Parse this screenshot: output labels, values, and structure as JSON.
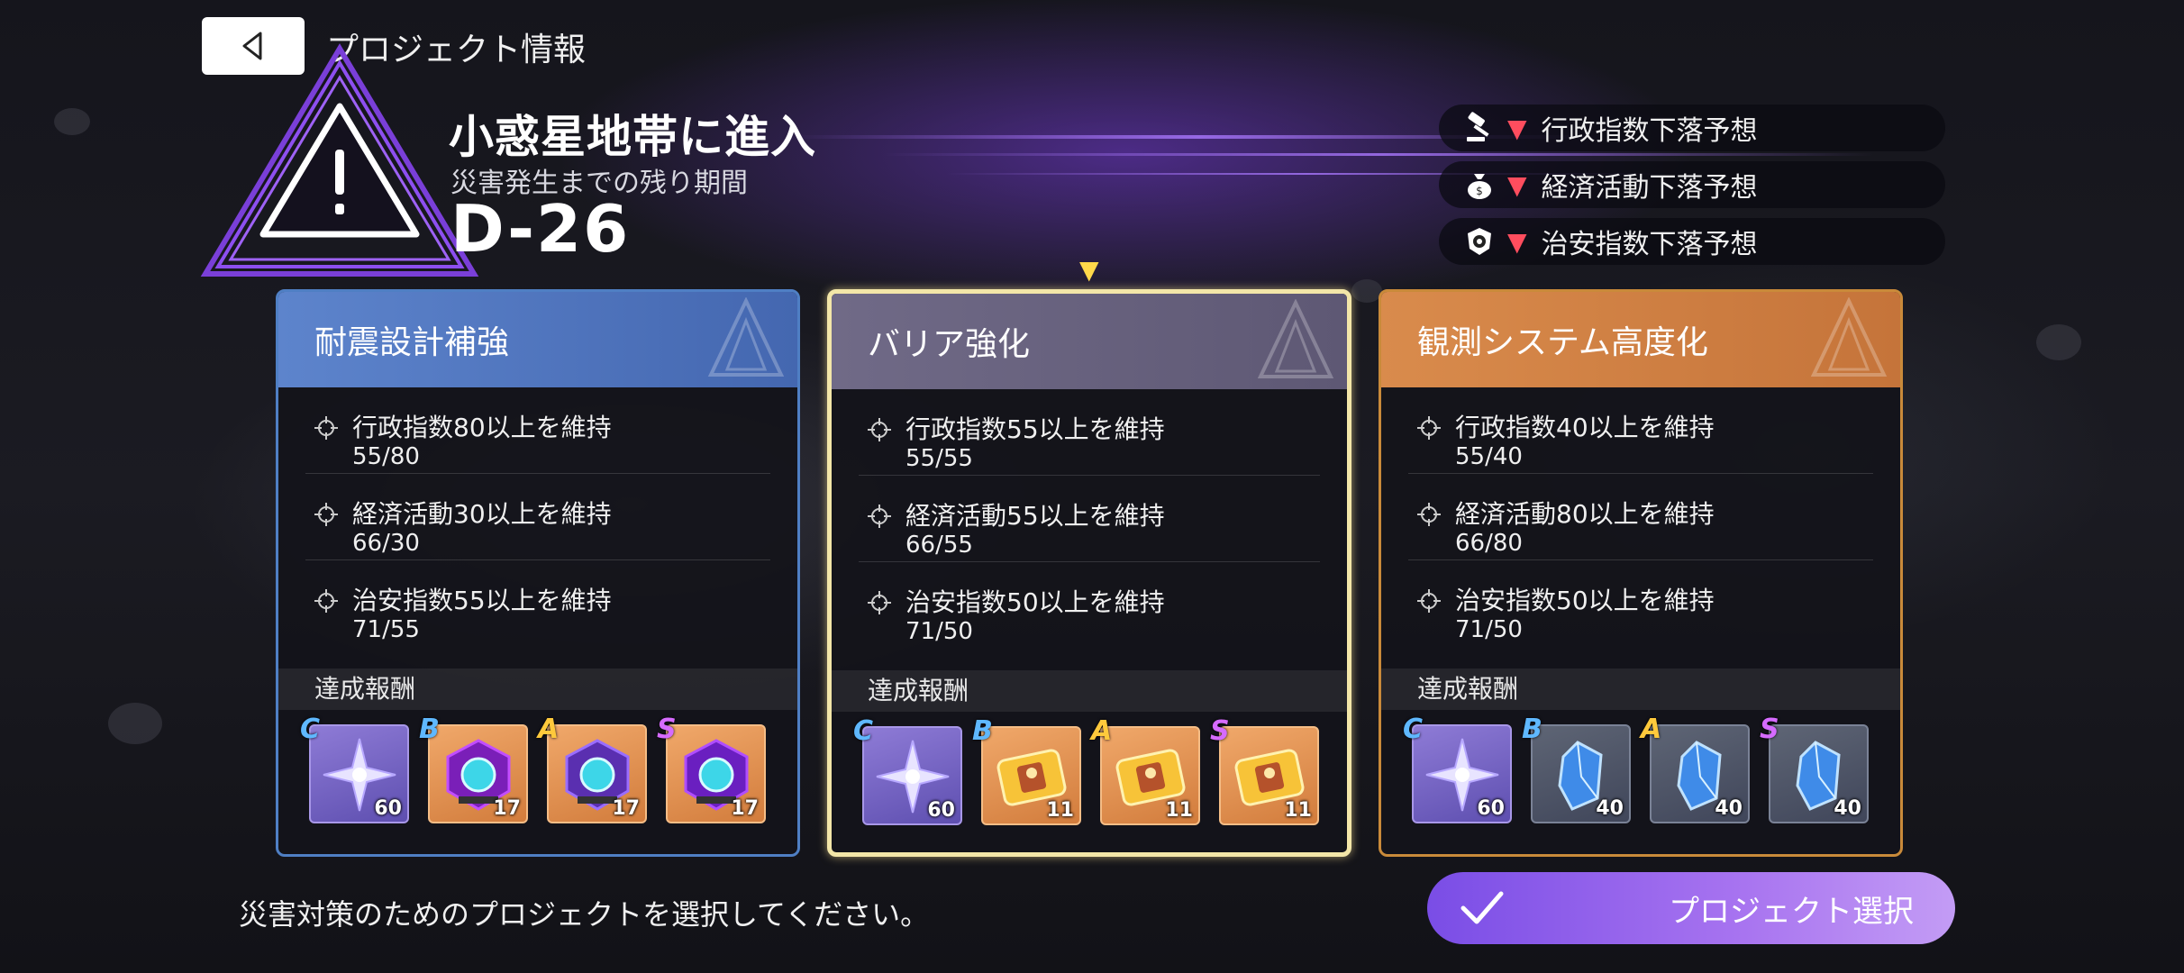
{
  "header": {
    "title": "プロジェクト情報"
  },
  "event": {
    "title": "小惑星地帯に進入",
    "subtitle": "災害発生までの残り期間",
    "countdown": "D-26"
  },
  "forecasts": [
    {
      "icon": "gavel-icon",
      "text": "行政指数下落予想"
    },
    {
      "icon": "money-bag-icon",
      "text": "経済活動下落予想"
    },
    {
      "icon": "police-badge-icon",
      "text": "治安指数下落予想"
    }
  ],
  "selected_marker": "▼",
  "reward_label": "達成報酬",
  "cards": [
    {
      "title": "耐震設計補強",
      "theme": "blue",
      "conditions": [
        {
          "text": "行政指数80以上を維持",
          "progress": "55/80"
        },
        {
          "text": "経済活動30以上を維持",
          "progress": "66/30"
        },
        {
          "text": "治安指数55以上を維持",
          "progress": "71/55"
        }
      ],
      "rewards": [
        {
          "grade": "C",
          "item": "crystal-star-icon",
          "count": "60"
        },
        {
          "grade": "B",
          "item": "core-chip-icon",
          "count": "17"
        },
        {
          "grade": "A",
          "item": "core-chip-icon",
          "count": "17"
        },
        {
          "grade": "S",
          "item": "core-chip-icon",
          "count": "17"
        }
      ]
    },
    {
      "title": "バリア強化",
      "theme": "violet",
      "conditions": [
        {
          "text": "行政指数55以上を維持",
          "progress": "55/55"
        },
        {
          "text": "経済活動55以上を維持",
          "progress": "66/55"
        },
        {
          "text": "治安指数50以上を維持",
          "progress": "71/50"
        }
      ],
      "rewards": [
        {
          "grade": "C",
          "item": "crystal-star-icon",
          "count": "60"
        },
        {
          "grade": "B",
          "item": "gold-ticket-icon",
          "count": "11"
        },
        {
          "grade": "A",
          "item": "gold-ticket-icon",
          "count": "11"
        },
        {
          "grade": "S",
          "item": "gold-ticket-icon",
          "count": "11"
        }
      ]
    },
    {
      "title": "観測システム高度化",
      "theme": "orange",
      "conditions": [
        {
          "text": "行政指数40以上を維持",
          "progress": "55/40"
        },
        {
          "text": "経済活動80以上を維持",
          "progress": "66/80"
        },
        {
          "text": "治安指数50以上を維持",
          "progress": "71/50"
        }
      ],
      "rewards": [
        {
          "grade": "C",
          "item": "crystal-star-icon",
          "count": "60"
        },
        {
          "grade": "B",
          "item": "blue-crystal-icon",
          "count": "40"
        },
        {
          "grade": "A",
          "item": "blue-crystal-icon",
          "count": "40"
        },
        {
          "grade": "S",
          "item": "blue-crystal-icon",
          "count": "40"
        }
      ]
    }
  ],
  "footer": {
    "message": "災害対策のためのプロジェクトを選択してください。",
    "select_button": "プロジェクト選択"
  },
  "colors": {
    "accent_purple": "#8a5cf0",
    "selected_border": "#f3e6a8",
    "down_arrow": "#ff4d5e"
  }
}
